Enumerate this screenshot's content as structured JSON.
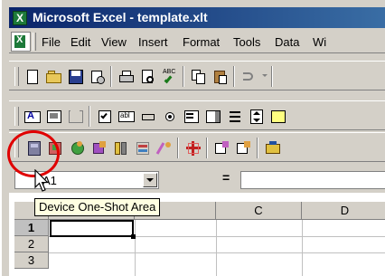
{
  "window": {
    "title": "Microsoft Excel - template.xlt"
  },
  "menubar": {
    "items": [
      "File",
      "Edit",
      "View",
      "Insert",
      "Format",
      "Tools",
      "Data",
      "Wi"
    ]
  },
  "formula_bar": {
    "name_box": "A1",
    "equals": "="
  },
  "grid": {
    "columns": [
      "C",
      "D"
    ],
    "rows": [
      "1",
      "2",
      "3"
    ],
    "active_cell": "A1"
  },
  "tooltip": {
    "text": "Device One-Shot Area"
  },
  "colors": {
    "highlight_circle": "#e00000",
    "title_bar": "#0a246a",
    "tooltip_bg": "#ffffe1"
  },
  "toolbars": {
    "standard": [
      "new-icon",
      "open-icon",
      "save-icon",
      "permission-icon",
      "print-icon",
      "print-preview-icon",
      "spelling-icon",
      "copy-icon",
      "paste-icon",
      "undo-icon"
    ],
    "forms": [
      "label-icon",
      "edit-box-icon",
      "group-box-icon",
      "button-icon",
      "checkbox-icon",
      "option-button-icon",
      "list-box-icon",
      "combo-box-icon",
      "scroll-bar-icon",
      "spinner-icon"
    ],
    "custom": [
      "device-one-shot-area-icon",
      "device-icon-2",
      "device-icon-3",
      "device-icon-4",
      "device-icon-5",
      "device-icon-6",
      "device-icon-7",
      "device-icon-8",
      "device-icon-9",
      "device-icon-10",
      "device-icon-11"
    ]
  }
}
